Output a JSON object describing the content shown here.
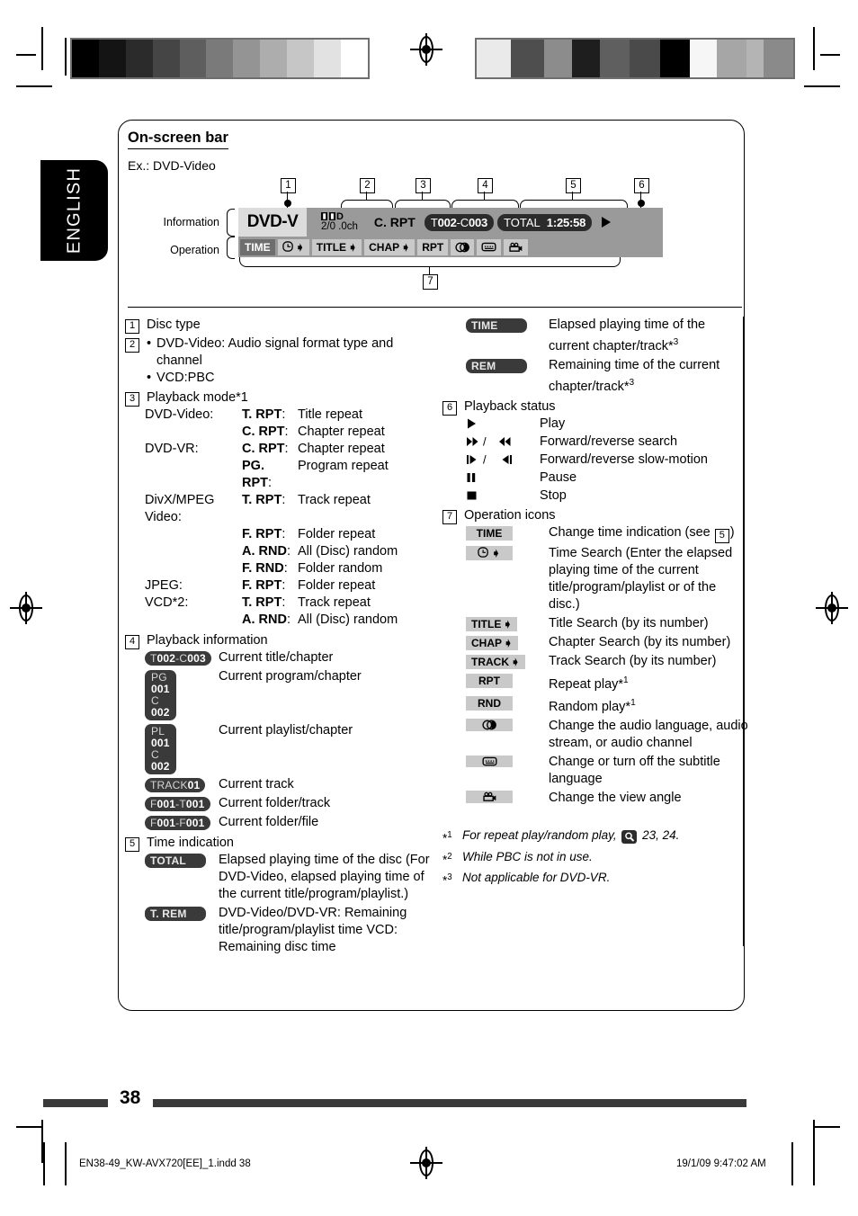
{
  "language_tab": "ENGLISH",
  "section": {
    "title": "On-screen bar",
    "example_label": "Ex.: DVD-Video"
  },
  "diagram": {
    "row_labels": {
      "information": "Information",
      "operation": "Operation"
    },
    "callouts": [
      "1",
      "2",
      "3",
      "4",
      "5",
      "6",
      "7"
    ],
    "info_bar": {
      "disc_type": "DVD-V",
      "audio_format": "D",
      "audio_channel": "2/0 .0ch",
      "playback_mode": "C. RPT",
      "title_chapter": {
        "prefix1": "T",
        "num1": "002",
        "sep": "-",
        "prefix2": "C",
        "num2": "003"
      },
      "time_label": "TOTAL",
      "time_value": "1:25:58",
      "status_icon": "play-triangle"
    },
    "operation_bar": [
      {
        "label": "TIME",
        "selected": true,
        "arrow": false
      },
      {
        "label": "",
        "icon": "clock-arrow-icon",
        "selected": false,
        "arrow": true
      },
      {
        "label": "TITLE",
        "selected": false,
        "arrow": true
      },
      {
        "label": "CHAP",
        "selected": false,
        "arrow": true
      },
      {
        "label": "RPT",
        "selected": false,
        "arrow": false
      },
      {
        "label": "",
        "icon": "audio-channel-icon",
        "selected": false,
        "arrow": false
      },
      {
        "label": "",
        "icon": "subtitle-icon",
        "selected": false,
        "arrow": false
      },
      {
        "label": "",
        "icon": "view-angle-icon",
        "selected": false,
        "arrow": false
      }
    ]
  },
  "left_column": {
    "item1": {
      "num": "1",
      "text": "Disc type"
    },
    "item2": {
      "num": "2",
      "bullets": [
        "DVD-Video: Audio signal format type and channel",
        "VCD:PBC"
      ]
    },
    "item3": {
      "num": "3",
      "heading": "Playback mode*1",
      "rows": [
        {
          "format": "DVD-Video:",
          "code": "T. RPT",
          "desc": "Title repeat"
        },
        {
          "format": "",
          "code": "C. RPT",
          "desc": "Chapter repeat"
        },
        {
          "format": "DVD-VR:",
          "code": "C. RPT",
          "desc": "Chapter repeat"
        },
        {
          "format": "",
          "code": "PG. RPT",
          "desc": "Program repeat"
        },
        {
          "format": "DivX/MPEG Video:",
          "code": "T. RPT",
          "desc": "Track repeat"
        },
        {
          "format": "",
          "code": "F. RPT",
          "desc": "Folder repeat"
        },
        {
          "format": "",
          "code": "A. RND",
          "desc": "All (Disc) random"
        },
        {
          "format": "",
          "code": "F. RND",
          "desc": "Folder random"
        },
        {
          "format": "JPEG:",
          "code": "F. RPT",
          "desc": "Folder repeat"
        },
        {
          "format": "VCD*2:",
          "code": "T. RPT",
          "desc": "Track repeat"
        },
        {
          "format": "",
          "code": "A. RND",
          "desc": "All (Disc) random"
        }
      ]
    },
    "item4": {
      "num": "4",
      "heading": "Playback information",
      "rows": [
        {
          "badge_type": "single",
          "badge": "T002-C003",
          "desc": "Current title/chapter"
        },
        {
          "badge_type": "double",
          "badge_l1": "PG001",
          "badge_l2": "C002",
          "desc": "Current program/chapter"
        },
        {
          "badge_type": "double",
          "badge_l1": "PL001",
          "badge_l2": "C002",
          "desc": "Current playlist/chapter"
        },
        {
          "badge_type": "single",
          "badge": "TRACK 01",
          "desc": "Current track"
        },
        {
          "badge_type": "single",
          "badge": "F001-T001",
          "desc": "Current folder/track"
        },
        {
          "badge_type": "single",
          "badge": "F001-F001",
          "desc": "Current folder/file"
        }
      ]
    },
    "item5": {
      "num": "5",
      "heading": "Time indication",
      "rows": [
        {
          "badge": "TOTAL",
          "desc": "Elapsed playing time of the disc (For DVD-Video, elapsed playing time of the current title/program/playlist.)"
        },
        {
          "badge": "T. REM",
          "desc": "DVD-Video/DVD-VR: Remaining title/program/playlist time VCD: Remaining disc time"
        }
      ]
    }
  },
  "right_column": {
    "time_rows": [
      {
        "badge": "TIME",
        "desc": "Elapsed playing time of the current chapter/track*3"
      },
      {
        "badge": "REM",
        "desc": "Remaining time of the current chapter/track*3"
      }
    ],
    "item6": {
      "num": "6",
      "heading": "Playback status",
      "rows": [
        {
          "glyph": "play-icon",
          "desc": "Play"
        },
        {
          "glyph": "forward-reverse-search-icon",
          "desc": "Forward/reverse search"
        },
        {
          "glyph": "slow-motion-icon",
          "desc": "Forward/reverse slow-motion"
        },
        {
          "glyph": "pause-icon",
          "desc": "Pause"
        },
        {
          "glyph": "stop-icon",
          "desc": "Stop"
        }
      ]
    },
    "item7": {
      "num": "7",
      "heading": "Operation icons",
      "rows": [
        {
          "btn": "TIME",
          "arrow": false,
          "desc_pre": "Change time indication (see ",
          "ref": "5",
          "desc_post": ")"
        },
        {
          "btn": "",
          "icon": "clock-arrow-icon",
          "arrow": true,
          "desc": "Time Search (Enter the elapsed playing time of the current title/program/playlist or of the disc.)"
        },
        {
          "btn": "TITLE",
          "arrow": true,
          "desc": "Title Search (by its number)"
        },
        {
          "btn": "CHAP",
          "arrow": true,
          "desc": "Chapter Search (by its number)"
        },
        {
          "btn": "TRACK",
          "arrow": true,
          "desc": "Track Search (by its number)"
        },
        {
          "btn": "RPT",
          "arrow": false,
          "desc": "Repeat play*1"
        },
        {
          "btn": "RND",
          "arrow": false,
          "desc": "Random play*1"
        },
        {
          "btn": "",
          "icon": "audio-channel-icon",
          "arrow": false,
          "desc": "Change the audio language, audio stream, or audio channel"
        },
        {
          "btn": "",
          "icon": "subtitle-icon",
          "arrow": false,
          "desc": "Change or turn off the subtitle language"
        },
        {
          "btn": "",
          "icon": "view-angle-icon",
          "arrow": false,
          "desc": "Change the view angle"
        }
      ]
    },
    "footnotes": [
      {
        "marker": "*1",
        "text_pre": "For repeat play/random play, ",
        "icon": "magnifier-icon",
        "text_post": " 23, 24."
      },
      {
        "marker": "*2",
        "text_pre": "While PBC is not in use.",
        "icon": "",
        "text_post": ""
      },
      {
        "marker": "*3",
        "text_pre": "Not applicable for DVD-VR.",
        "icon": "",
        "text_post": ""
      }
    ]
  },
  "footer": {
    "page_number": "38",
    "file_name": "EN38-49_KW-AVX720[EE]_1.indd   38",
    "timestamp": "19/1/09   9:47:02 AM"
  },
  "colors": {
    "bar_background": "#9a9a9a",
    "disc_type_bg": "#dcdcdc",
    "button_bg": "#c9c9c9",
    "button_selected_bg": "#6e6e6e",
    "badge_bg": "#3a3a3a",
    "footer_bar": "#3a3a3a"
  }
}
